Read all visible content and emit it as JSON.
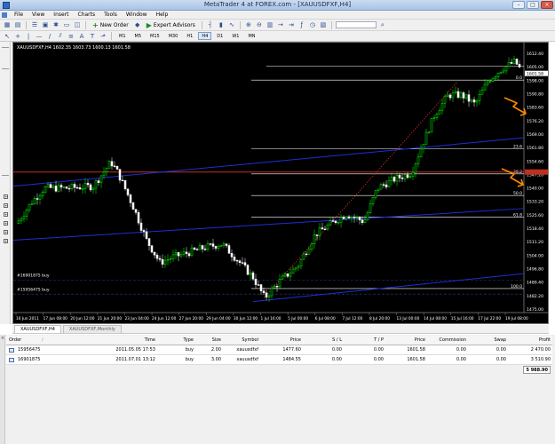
{
  "window": {
    "title": "MetaTrader 4 at FOREX.com - [XAUUSDFXF,H4]"
  },
  "menu": [
    "File",
    "View",
    "Insert",
    "Charts",
    "Tools",
    "Window",
    "Help"
  ],
  "toolbar": {
    "new_order": "New Order",
    "expert_advisors": "Expert Advisors"
  },
  "timeframes": [
    "M1",
    "M5",
    "M15",
    "M30",
    "H1",
    "H4",
    "D1",
    "W1",
    "MN"
  ],
  "active_timeframe": "H4",
  "chart": {
    "header": "XAUUSDFXF,H4  1602.35 1603.73 1600.13 1601.58",
    "price_labels": [
      "1612.40",
      "1605.00",
      "1598.00",
      "1590.80",
      "1583.60",
      "1576.20",
      "1569.00",
      "1561.80",
      "1554.60",
      "1547.20",
      "1540.00",
      "1533.20",
      "1525.60",
      "1518.40",
      "1511.20",
      "1504.00",
      "1496.80",
      "1489.40",
      "1482.20",
      "1475.00"
    ],
    "current_price": "1601.58",
    "fib_labels": [
      "0.0",
      "23.6",
      "38.2",
      "50.0",
      "61.8",
      "100.0"
    ],
    "order_labels": [
      "#16901875 buy",
      "#15956475 buy"
    ],
    "time_labels": [
      "16 Jun 2011",
      "17 Jun 08:00",
      "20 Jun 12:00",
      "21 Jun 20:00",
      "23 Jun 04:00",
      "24 Jun 12:00",
      "27 Jun 20:00",
      "29 Jun 04:00",
      "30 Jun 12:00",
      "1 Jul 16:00",
      "5 Jul 00:00",
      "6 Jul 08:00",
      "7 Jul 12:00",
      "8 Jul 20:00",
      "13 Jul 00:00",
      "14 Jul 08:00",
      "15 Jul 16:00",
      "17 Jul 22:00",
      "19 Jul 08:00"
    ],
    "colors": {
      "candle_up": "#00ff00",
      "candle_down": "#ffffff",
      "trend_line": "#1e2fd6",
      "fib_line": "#ffffff",
      "red_line": "#c03020",
      "arrow": "#ff8a00"
    }
  },
  "chart_tabs": [
    "XAUUSDFXF,H4",
    "XAUUSDFXF,Monthly"
  ],
  "active_chart_tab": "XAUUSDFXF,H4",
  "terminal": {
    "headers": [
      "Order",
      "/",
      "Time",
      "Type",
      "Size",
      "Symbol",
      "Price",
      "S / L",
      "T / P",
      "Price",
      "Commission",
      "Swap",
      "Profit"
    ],
    "orders": [
      {
        "order": "15956475",
        "time": "2011.05.05 17:53",
        "type": "buy",
        "size": "2.00",
        "symbol": "xauusdfxf",
        "open_price": "1477.60",
        "sl": "0.00",
        "tp": "0.00",
        "price": "1601.58",
        "commission": "0.00",
        "swap": "0.00",
        "profit": "2 470.00"
      },
      {
        "order": "16901875",
        "time": "2011.07.01 13:12",
        "type": "buy",
        "size": "3.00",
        "symbol": "xauusdfxf",
        "open_price": "1484.55",
        "sl": "0.00",
        "tp": "0.00",
        "price": "1601.58",
        "commission": "0.00",
        "swap": "0.00",
        "profit": "3 510.90"
      }
    ],
    "total_profit": "5 988.90"
  }
}
